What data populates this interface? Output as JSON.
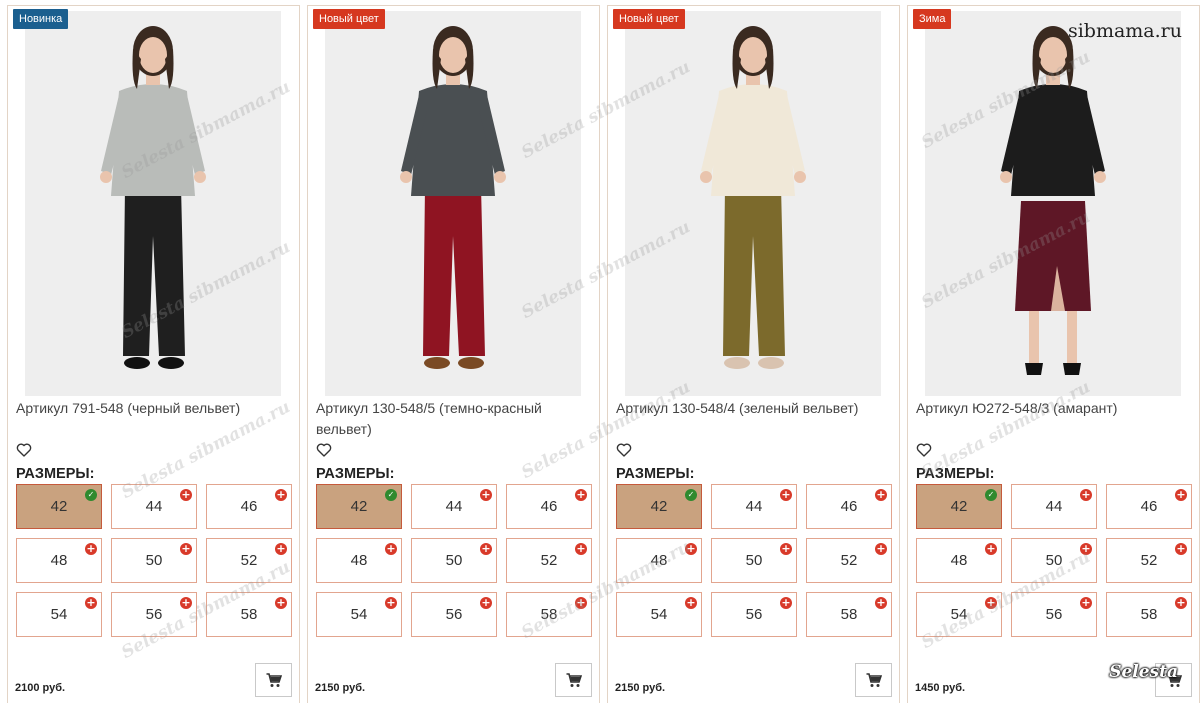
{
  "site_mark": "sibmama.ru",
  "brand_mark": "Selesta",
  "watermark_text": "Selesta sibmama.ru",
  "sizes_label": "РАЗМЕРЫ:",
  "colors": {
    "badge_blue": "#1b5f8f",
    "badge_red": "#d6381f",
    "selected_size": "#c9a27f",
    "available_mark": "#d83a2a",
    "selected_mark": "#2f8a2f"
  },
  "products": [
    {
      "badge": "Новинка",
      "badge_color": "blue",
      "title": "Артикул 791-548 (черный вельвет)",
      "price": "2100 руб.",
      "top_color": "#b9bcb9",
      "bottom_color": "#1f1f1f",
      "shoe_color": "#111111",
      "outfit": "trousers",
      "sizes": [
        "42",
        "44",
        "46",
        "48",
        "50",
        "52",
        "54",
        "56",
        "58"
      ],
      "selected_size": "42"
    },
    {
      "badge": "Новый цвет",
      "badge_color": "red",
      "title": "Артикул 130-548/5 (темно-красный вельвет)",
      "price": "2150 руб.",
      "top_color": "#4a4f52",
      "bottom_color": "#8f1422",
      "shoe_color": "#7a4a24",
      "outfit": "trousers",
      "sizes": [
        "42",
        "44",
        "46",
        "48",
        "50",
        "52",
        "54",
        "56",
        "58"
      ],
      "selected_size": "42"
    },
    {
      "badge": "Новый цвет",
      "badge_color": "red",
      "title": "Артикул 130-548/4 (зеленый вельвет)",
      "price": "2150 руб.",
      "top_color": "#f0e8d8",
      "bottom_color": "#7c6a2c",
      "shoe_color": "#d9c3b0",
      "outfit": "trousers",
      "sizes": [
        "42",
        "44",
        "46",
        "48",
        "50",
        "52",
        "54",
        "56",
        "58"
      ],
      "selected_size": "42"
    },
    {
      "badge": "Зима",
      "badge_color": "red",
      "title": "Артикул Ю272-548/3 (амарант)",
      "price": "1450 руб.",
      "top_color": "#1c1c1c",
      "bottom_color": "#5e1726",
      "shoe_color": "#111111",
      "outfit": "skirt",
      "sizes": [
        "42",
        "44",
        "46",
        "48",
        "50",
        "52",
        "54",
        "56",
        "58"
      ],
      "selected_size": "42"
    }
  ]
}
